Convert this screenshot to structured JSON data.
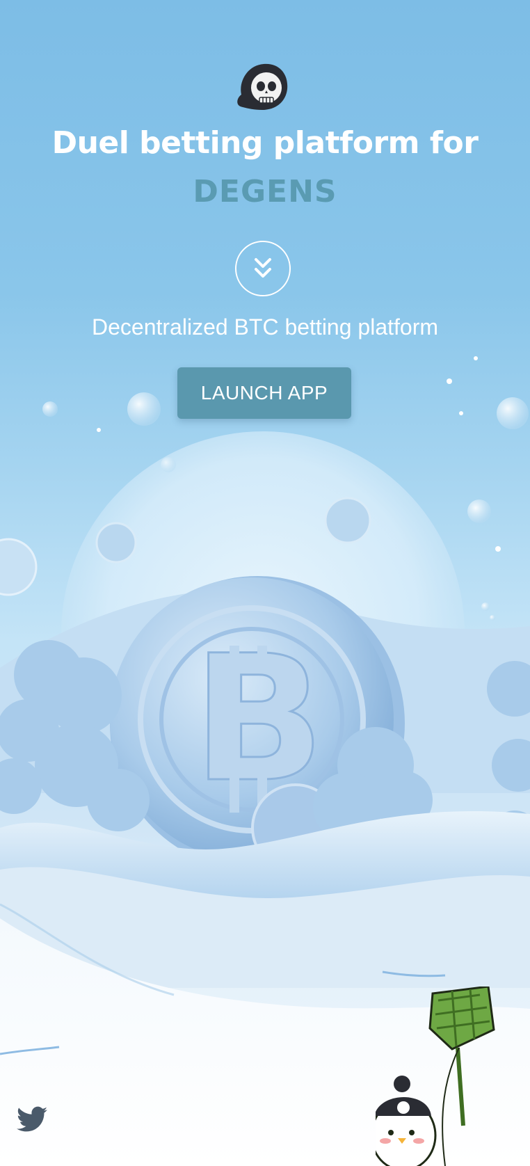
{
  "hero": {
    "headline": "Duel betting platform for",
    "highlight": "DEGENS",
    "tagline": "Decentralized BTC betting platform",
    "cta_label": "LAUNCH APP"
  },
  "icons": {
    "logo": "skull-hood-icon",
    "scroll": "chevrons-down-icon",
    "social": "twitter-icon",
    "mascot": "penguin-kite-icon",
    "background": "btc-coin-icon"
  },
  "colors": {
    "sky": "#7dbde6",
    "highlight": "#5a9bb2",
    "cta": "#5a98ae",
    "text": "#ffffff"
  }
}
